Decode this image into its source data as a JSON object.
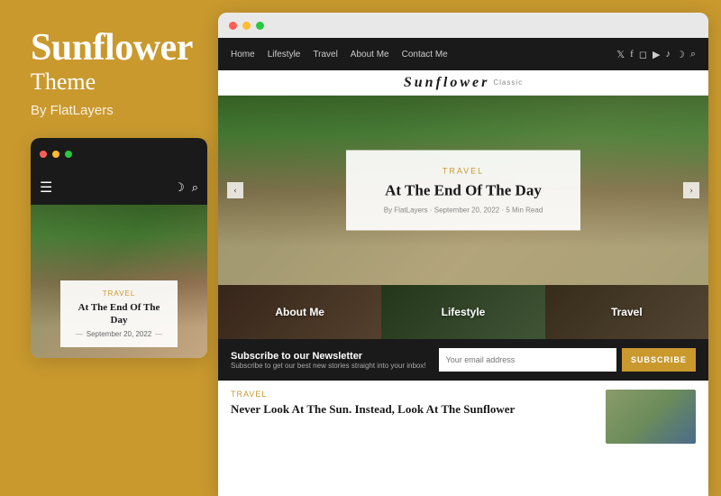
{
  "left": {
    "title": "Sunflower",
    "subtitle": "Theme",
    "by": "By FlatLayers",
    "mobile": {
      "hero_category": "Travel",
      "hero_title": "At The End Of The Day",
      "hero_date": "September 20, 2022"
    }
  },
  "browser": {
    "nav": {
      "links": [
        "Home",
        "Lifestyle",
        "Travel",
        "About Me",
        "Contact Me"
      ],
      "icons": [
        "twitter",
        "facebook",
        "instagram",
        "youtube",
        "tiktok",
        "moon",
        "search"
      ]
    },
    "logo": {
      "name": "Sunflower",
      "sub": "Classic"
    },
    "hero": {
      "category": "Travel",
      "title": "At The End Of The Day",
      "meta": "By FlatLayers · September 20, 2022 · 5 Min Read"
    },
    "categories": [
      "About Me",
      "Lifestyle",
      "Travel"
    ],
    "newsletter": {
      "title": "Subscribe to our Newsletter",
      "subtitle": "Subscribe to get our best new stories straight into your inbox!",
      "input_placeholder": "Your email address",
      "button": "SUBSCRIBE"
    },
    "bottom_post": {
      "category": "Travel",
      "title": "Never Look At The Sun. Instead, Look At The Sunflower"
    }
  },
  "colors": {
    "accent": "#C9992E",
    "dark": "#1a1a1a"
  }
}
